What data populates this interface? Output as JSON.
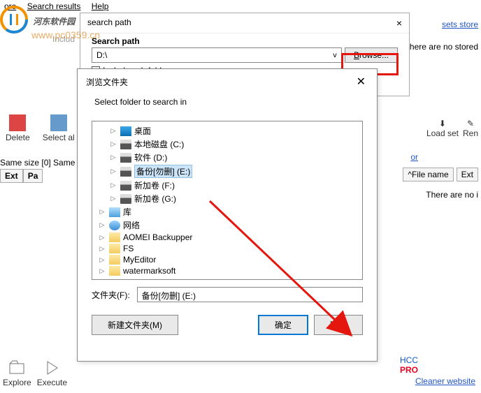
{
  "bg": {
    "menu_items": [
      "ore",
      "Search results",
      "Help"
    ],
    "toolbar": {
      "delete": "Delete",
      "select_all": "Select al"
    },
    "right_link": "sets store",
    "right_text": "There are no stored",
    "right_toolbar": {
      "load": "Load set",
      "rename": "Ren"
    },
    "right_or": "or",
    "right_cols": {
      "file": "File name",
      "ext": "Ext"
    },
    "right_noitem": "There are no i",
    "samesize": "Same size [0]   Same",
    "cols": {
      "ext": "Ext",
      "path": "Pa"
    },
    "bottom": {
      "explore": "Explore",
      "execute": "Execute"
    },
    "cleaner": "Cleaner website",
    "pro_hcc": "HCC",
    "pro_label": "PRO"
  },
  "watermark": {
    "brand": "河东软件园",
    "url": "www.pc0359.cn"
  },
  "dlg1": {
    "title": "search path",
    "include_label": "Includ",
    "search_path_label": "Search path",
    "path_value": "D:\\",
    "browse_btn": "Browse...",
    "include_sub": "Include sub folders"
  },
  "dlg2": {
    "title": "浏览文件夹",
    "instruction": "Select folder to search in",
    "tree": [
      {
        "icon": "desktop",
        "label": "桌面",
        "level": 1
      },
      {
        "icon": "drive",
        "label": "本地磁盘 (C:)",
        "level": 1
      },
      {
        "icon": "drive",
        "label": "软件 (D:)",
        "level": 1
      },
      {
        "icon": "drive",
        "label": "备份[勿删] (E:)",
        "level": 1,
        "selected": true
      },
      {
        "icon": "drive",
        "label": "新加卷 (F:)",
        "level": 1
      },
      {
        "icon": "drive",
        "label": "新加卷 (G:)",
        "level": 1
      },
      {
        "icon": "lib",
        "label": "库",
        "level": 0
      },
      {
        "icon": "net",
        "label": "网络",
        "level": 0
      },
      {
        "icon": "folder",
        "label": "AOMEI Backupper",
        "level": 0
      },
      {
        "icon": "folder",
        "label": "FS",
        "level": 0
      },
      {
        "icon": "folder",
        "label": "MyEditor",
        "level": 0
      },
      {
        "icon": "folder",
        "label": "watermarksoft",
        "level": 0
      }
    ],
    "folder_label": "文件夹(F):",
    "folder_value": "备份[勿删] (E:)",
    "new_folder_btn": "新建文件夹(M)",
    "ok_btn": "确定",
    "cancel_btn": "取消"
  }
}
